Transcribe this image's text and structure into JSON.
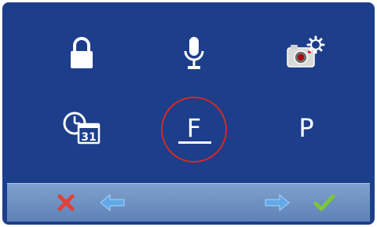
{
  "menu": {
    "items": [
      {
        "icon": "lock-icon"
      },
      {
        "icon": "microphone-icon"
      },
      {
        "icon": "camera-settings-icon"
      },
      {
        "icon": "clock-calendar-icon",
        "calendar_day": "31"
      },
      {
        "label": "F",
        "selected": true
      },
      {
        "label": "P"
      }
    ]
  },
  "toolbar": {
    "buttons": [
      {
        "icon": "close-icon"
      },
      {
        "icon": "arrow-left-icon"
      },
      {
        "icon": "arrow-right-icon"
      },
      {
        "icon": "check-icon"
      }
    ]
  },
  "colors": {
    "background": "#1d3e8a",
    "selection_ring": "#d42a22",
    "toolbar": "#6f91c2",
    "close": "#e0413a",
    "check": "#7cc63a",
    "arrow": "#63a9e8"
  }
}
